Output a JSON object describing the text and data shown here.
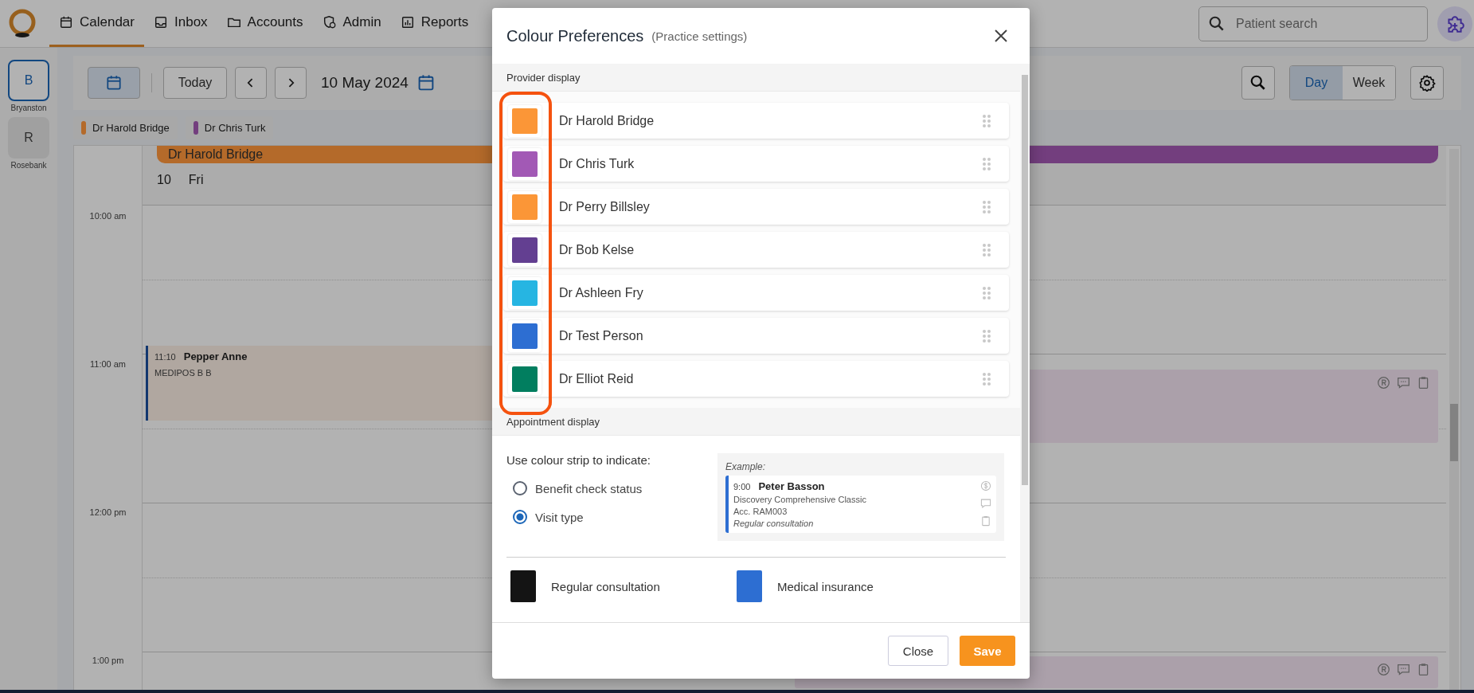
{
  "nav": {
    "tabs": [
      {
        "label": "Calendar",
        "selected": true
      },
      {
        "label": "Inbox",
        "selected": false
      },
      {
        "label": "Accounts",
        "selected": false
      },
      {
        "label": "Admin",
        "selected": false
      },
      {
        "label": "Reports",
        "selected": false
      }
    ],
    "search": {
      "placeholder": "Patient search"
    }
  },
  "locations": [
    {
      "initial": "B",
      "name": "Bryanston",
      "selected": true
    },
    {
      "initial": "R",
      "name": "Rosebank",
      "selected": false
    }
  ],
  "toolbar": {
    "today": "Today",
    "date": "10 May 2024",
    "views": [
      {
        "label": "Day",
        "selected": true
      },
      {
        "label": "Week",
        "selected": false
      }
    ]
  },
  "provider_chips": [
    {
      "name": "Dr Harold Bridge",
      "color": "#b46a2a"
    },
    {
      "name": "Dr Chris Turk",
      "color": "#733e7e"
    }
  ],
  "calendar": {
    "columns": [
      {
        "label": "Dr Harold Bridge",
        "color": "#b46a2a"
      },
      {
        "color": "#733e7e"
      }
    ],
    "day_number": "10",
    "weekday": "Fri",
    "times": [
      "10:00 am",
      "11:00 am",
      "12:00 pm",
      "1:00 pm"
    ],
    "appointment": {
      "time": "11:10",
      "patient": "Pepper Anne",
      "detail": "MEDIPOS B B"
    }
  },
  "dialog": {
    "title": "Colour Preferences",
    "subtitle": "(Practice settings)",
    "provider_heading": "Provider display",
    "providers": [
      {
        "name": "Dr Harold Bridge",
        "color": "#fb9637"
      },
      {
        "name": "Dr Chris Turk",
        "color": "#a259b5"
      },
      {
        "name": "Dr Perry Billsley",
        "color": "#fb9637"
      },
      {
        "name": "Dr Bob Kelse",
        "color": "#633f91"
      },
      {
        "name": "Dr Ashleen Fry",
        "color": "#26b5e2"
      },
      {
        "name": "Dr Test Person",
        "color": "#2d6ed2"
      },
      {
        "name": "Dr Elliot Reid",
        "color": "#017e5f"
      }
    ],
    "appointment_heading": "Appointment display",
    "prompt": "Use colour strip to indicate:",
    "options": [
      {
        "label": "Benefit check status",
        "selected": false
      },
      {
        "label": "Visit type",
        "selected": true
      }
    ],
    "example": {
      "caption": "Example:",
      "time": "9:00",
      "patient": "Peter Basson",
      "lines": [
        "Discovery Comprehensive Classic",
        "Acc. RAM003"
      ],
      "visit_type": "Regular consultation",
      "color": "#2d6ed2"
    },
    "visit_types": [
      {
        "label": "Regular consultation",
        "color": "#141414"
      },
      {
        "label": "Medical insurance",
        "color": "#2d6ed2"
      }
    ],
    "buttons": {
      "close": "Close",
      "save": "Save"
    }
  }
}
